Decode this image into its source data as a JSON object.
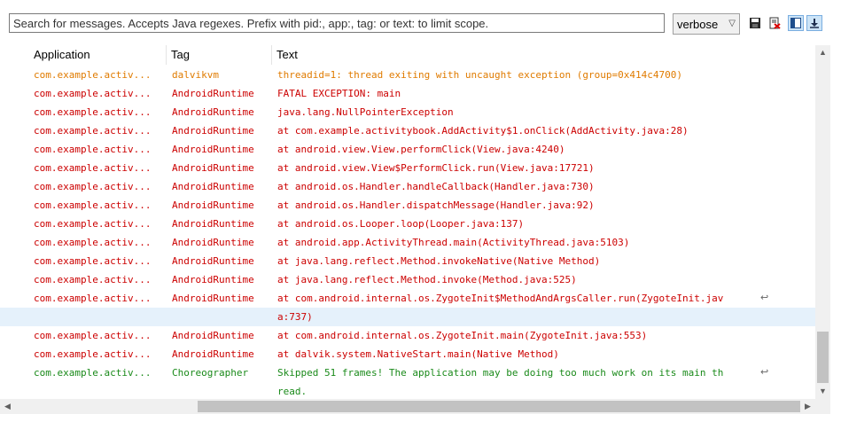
{
  "search": {
    "placeholder": "Search for messages. Accepts Java regexes. Prefix with pid:, app:, tag: or text: to limit scope."
  },
  "level": {
    "selected": "verbose"
  },
  "toolbar": {
    "icons": [
      "save-icon",
      "clear-log-icon",
      "panel-toggle-icon",
      "scroll-lock-icon"
    ]
  },
  "colors": {
    "warn": "#e07b00",
    "error": "#cc0000",
    "debug": "#1a8a1a",
    "selected_row": "#e5f1fb"
  },
  "columns": {
    "application": "Application",
    "tag": "Tag",
    "text": "Text"
  },
  "rows": [
    {
      "app": "com.example.activ...",
      "tag": "dalvikvm",
      "text": "threadid=1: thread exiting with uncaught exception (group=0x414c4700)",
      "level": "warn"
    },
    {
      "app": "com.example.activ...",
      "tag": "AndroidRuntime",
      "text": "FATAL EXCEPTION: main",
      "level": "error"
    },
    {
      "app": "com.example.activ...",
      "tag": "AndroidRuntime",
      "text": "java.lang.NullPointerException",
      "level": "error"
    },
    {
      "app": "com.example.activ...",
      "tag": "AndroidRuntime",
      "text": "at com.example.activitybook.AddActivity$1.onClick(AddActivity.java:28)",
      "level": "error"
    },
    {
      "app": "com.example.activ...",
      "tag": "AndroidRuntime",
      "text": "at android.view.View.performClick(View.java:4240)",
      "level": "error"
    },
    {
      "app": "com.example.activ...",
      "tag": "AndroidRuntime",
      "text": "at android.view.View$PerformClick.run(View.java:17721)",
      "level": "error"
    },
    {
      "app": "com.example.activ...",
      "tag": "AndroidRuntime",
      "text": "at android.os.Handler.handleCallback(Handler.java:730)",
      "level": "error"
    },
    {
      "app": "com.example.activ...",
      "tag": "AndroidRuntime",
      "text": "at android.os.Handler.dispatchMessage(Handler.java:92)",
      "level": "error"
    },
    {
      "app": "com.example.activ...",
      "tag": "AndroidRuntime",
      "text": "at android.os.Looper.loop(Looper.java:137)",
      "level": "error"
    },
    {
      "app": "com.example.activ...",
      "tag": "AndroidRuntime",
      "text": "at android.app.ActivityThread.main(ActivityThread.java:5103)",
      "level": "error"
    },
    {
      "app": "com.example.activ...",
      "tag": "AndroidRuntime",
      "text": "at java.lang.reflect.Method.invokeNative(Native Method)",
      "level": "error"
    },
    {
      "app": "com.example.activ...",
      "tag": "AndroidRuntime",
      "text": "at java.lang.reflect.Method.invoke(Method.java:525)",
      "level": "error"
    },
    {
      "app": "com.example.activ...",
      "tag": "AndroidRuntime",
      "text": "at com.android.internal.os.ZygoteInit$MethodAndArgsCaller.run(ZygoteInit.jav",
      "level": "error",
      "wrap": true
    },
    {
      "app": "",
      "tag": "",
      "text": "a:737)",
      "level": "error",
      "selected": true
    },
    {
      "app": "com.example.activ...",
      "tag": "AndroidRuntime",
      "text": "at com.android.internal.os.ZygoteInit.main(ZygoteInit.java:553)",
      "level": "error"
    },
    {
      "app": "com.example.activ...",
      "tag": "AndroidRuntime",
      "text": "at dalvik.system.NativeStart.main(Native Method)",
      "level": "error"
    },
    {
      "app": "com.example.activ...",
      "tag": "Choreographer",
      "text": "Skipped 51 frames!  The application may be doing too much work on its main th",
      "level": "debug",
      "wrap": true
    },
    {
      "app": "",
      "tag": "",
      "text": "read.",
      "level": "debug"
    }
  ]
}
